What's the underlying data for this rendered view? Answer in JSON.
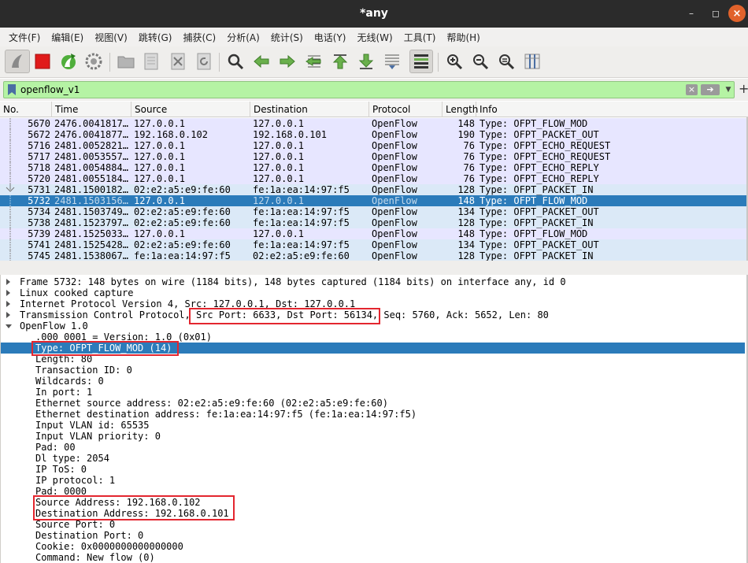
{
  "window": {
    "title": "*any"
  },
  "menu": [
    "文件(F)",
    "编辑(E)",
    "视图(V)",
    "跳转(G)",
    "捕获(C)",
    "分析(A)",
    "统计(S)",
    "电话(Y)",
    "无线(W)",
    "工具(T)",
    "帮助(H)"
  ],
  "colors": {
    "selected": "#2b7bba",
    "filter_ok": "#b5f3a4",
    "row_blue": "#e7e6ff",
    "row_cyan": "#dbe9f7",
    "annotation": "#e3262f"
  },
  "filter": {
    "value": "openflow_v1"
  },
  "packet_list": {
    "columns": [
      "No.",
      "Time",
      "Source",
      "Destination",
      "Protocol",
      "Length",
      "Info"
    ],
    "rows": [
      {
        "no": "5670",
        "time": "2476.0041817…",
        "src": "127.0.0.1",
        "dst": "127.0.0.1",
        "proto": "OpenFlow",
        "len": "148",
        "info": "Type: OFPT_FLOW_MOD"
      },
      {
        "no": "5672",
        "time": "2476.0041877…",
        "src": "192.168.0.102",
        "dst": "192.168.0.101",
        "proto": "OpenFlow",
        "len": "190",
        "info": "Type: OFPT_PACKET_OUT"
      },
      {
        "no": "5716",
        "time": "2481.0052821…",
        "src": "127.0.0.1",
        "dst": "127.0.0.1",
        "proto": "OpenFlow",
        "len": "76",
        "info": "Type: OFPT_ECHO_REQUEST"
      },
      {
        "no": "5717",
        "time": "2481.0053557…",
        "src": "127.0.0.1",
        "dst": "127.0.0.1",
        "proto": "OpenFlow",
        "len": "76",
        "info": "Type: OFPT_ECHO_REQUEST"
      },
      {
        "no": "5718",
        "time": "2481.0054884…",
        "src": "127.0.0.1",
        "dst": "127.0.0.1",
        "proto": "OpenFlow",
        "len": "76",
        "info": "Type: OFPT_ECHO_REPLY"
      },
      {
        "no": "5720",
        "time": "2481.0055184…",
        "src": "127.0.0.1",
        "dst": "127.0.0.1",
        "proto": "OpenFlow",
        "len": "76",
        "info": "Type: OFPT_ECHO_REPLY"
      },
      {
        "no": "5731",
        "time": "2481.1500182…",
        "src": "02:e2:a5:e9:fe:60",
        "dst": "fe:1a:ea:14:97:f5",
        "proto": "OpenFlow",
        "len": "128",
        "info": "Type: OFPT_PACKET_IN"
      },
      {
        "no": "5732",
        "time": "2481.1503156…",
        "src": "127.0.0.1",
        "dst": "127.0.0.1",
        "proto": "OpenFlow",
        "len": "148",
        "info": "Type: OFPT_FLOW_MOD"
      },
      {
        "no": "5734",
        "time": "2481.1503749…",
        "src": "02:e2:a5:e9:fe:60",
        "dst": "fe:1a:ea:14:97:f5",
        "proto": "OpenFlow",
        "len": "134",
        "info": "Type: OFPT_PACKET_OUT"
      },
      {
        "no": "5738",
        "time": "2481.1523797…",
        "src": "02:e2:a5:e9:fe:60",
        "dst": "fe:1a:ea:14:97:f5",
        "proto": "OpenFlow",
        "len": "128",
        "info": "Type: OFPT_PACKET_IN"
      },
      {
        "no": "5739",
        "time": "2481.1525033…",
        "src": "127.0.0.1",
        "dst": "127.0.0.1",
        "proto": "OpenFlow",
        "len": "148",
        "info": "Type: OFPT_FLOW_MOD"
      },
      {
        "no": "5741",
        "time": "2481.1525428…",
        "src": "02:e2:a5:e9:fe:60",
        "dst": "fe:1a:ea:14:97:f5",
        "proto": "OpenFlow",
        "len": "134",
        "info": "Type: OFPT_PACKET_OUT"
      },
      {
        "no": "5745",
        "time": "2481.1538067…",
        "src": "fe:1a:ea:14:97:f5",
        "dst": "02:e2:a5:e9:fe:60",
        "proto": "OpenFlow",
        "len": "128",
        "info": "Type: OFPT_PACKET_IN"
      }
    ]
  },
  "details": {
    "frame": "Frame 5732: 148 bytes on wire (1184 bits), 148 bytes captured (1184 bits) on interface any, id 0",
    "linux": "Linux cooked capture",
    "ip": "Internet Protocol Version 4, Src: 127.0.0.1, Dst: 127.0.0.1",
    "tcp_a": "Transmission Control Protocol, ",
    "tcp_b": "Src Port: 6633, Dst Port: 56134,",
    "tcp_c": " Seq: 5760, Ack: 5652, Len: 80",
    "openflow": "OpenFlow 1.0",
    "fields": [
      ".000 0001 = Version: 1.0 (0x01)",
      "Type: OFPT_FLOW_MOD (14)",
      "Length: 80",
      "Transaction ID: 0",
      "Wildcards: 0",
      "In port: 1",
      "Ethernet source address: 02:e2:a5:e9:fe:60 (02:e2:a5:e9:fe:60)",
      "Ethernet destination address: fe:1a:ea:14:97:f5 (fe:1a:ea:14:97:f5)",
      "Input VLAN id: 65535",
      "Input VLAN priority: 0",
      "Pad: 00",
      "Dl type: 2054",
      "IP ToS: 0",
      "IP protocol: 1",
      "Pad: 0000",
      "Source Address: 192.168.0.102",
      "Destination Address: 192.168.0.101",
      "Source Port: 0",
      "Destination Port: 0",
      "Cookie: 0x0000000000000000",
      "Command: New flow (0)"
    ]
  }
}
